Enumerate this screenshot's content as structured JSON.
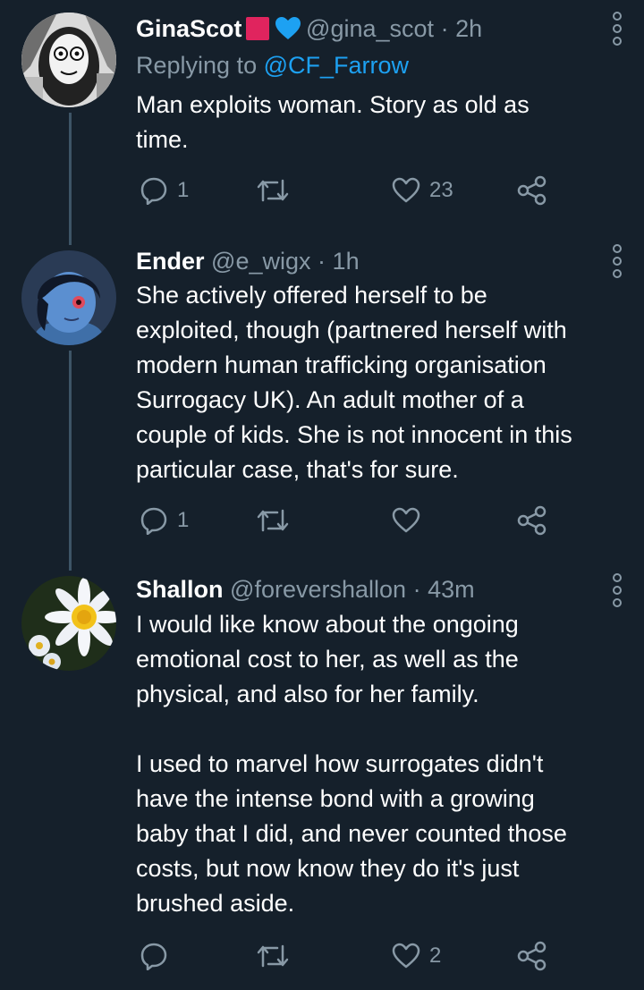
{
  "colors": {
    "background": "#15202b",
    "secondary_text": "#8899a6",
    "link": "#1da1f2",
    "thread_line": "#3d5466",
    "badge_red": "#e0245e",
    "badge_heart": "#1da1f2"
  },
  "tweets": [
    {
      "name": "GinaScot",
      "badges": [
        "red-square",
        "blue-heart"
      ],
      "handle": "@gina_scot",
      "separator": "·",
      "time": "2h",
      "replying_prefix": "Replying to ",
      "replying_to": "@CF_Farrow",
      "text": "Man exploits woman. Story as old as\ntime.",
      "replies": "1",
      "retweets": "",
      "likes": "23"
    },
    {
      "name": "Ender",
      "handle": "@e_wigx",
      "separator": "·",
      "time": "1h",
      "text": "She actively offered herself to be\nexploited, though (partnered herself with\nmodern human trafficking organisation\nSurrogacy UK). An adult mother of a\ncouple of kids. She is not innocent in this\nparticular case, that's for sure.",
      "replies": "1",
      "retweets": "",
      "likes": ""
    },
    {
      "name": "Shallon",
      "handle": "@forevershallon",
      "separator": "·",
      "time": "43m",
      "text": "I would like know about the ongoing\nemotional cost to her, as well as the\nphysical, and also for her family.\n\nI used to marvel how surrogates didn't\nhave the intense bond with a growing\nbaby that I did, and never counted those\ncosts, but now know they do it's just\nbrushed aside.",
      "replies": "",
      "retweets": "",
      "likes": "2"
    }
  ]
}
